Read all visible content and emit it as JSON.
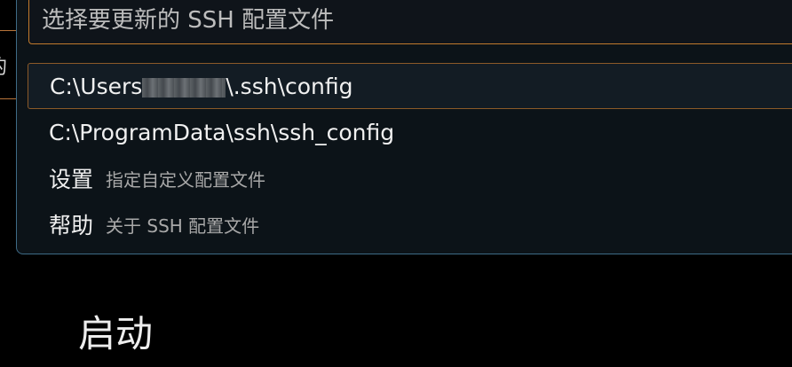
{
  "quick_pick": {
    "placeholder": "选择要更新的 SSH 配置文件",
    "items": [
      {
        "path_prefix": "C:\\Users",
        "path_suffix": "\\.ssh\\config",
        "selected": true
      },
      {
        "label": "C:\\ProgramData\\ssh\\ssh_config",
        "selected": false
      },
      {
        "label": "设置",
        "description": "指定自定义配置文件",
        "selected": false
      },
      {
        "label": "帮助",
        "description": "关于 SSH 配置文件",
        "selected": false
      }
    ]
  },
  "background": {
    "heading": "启动",
    "left_glyph": "的"
  },
  "colors": {
    "accent_border": "#c17a2c",
    "widget_border": "#3e6b86",
    "widget_bg": "#0c1318"
  }
}
